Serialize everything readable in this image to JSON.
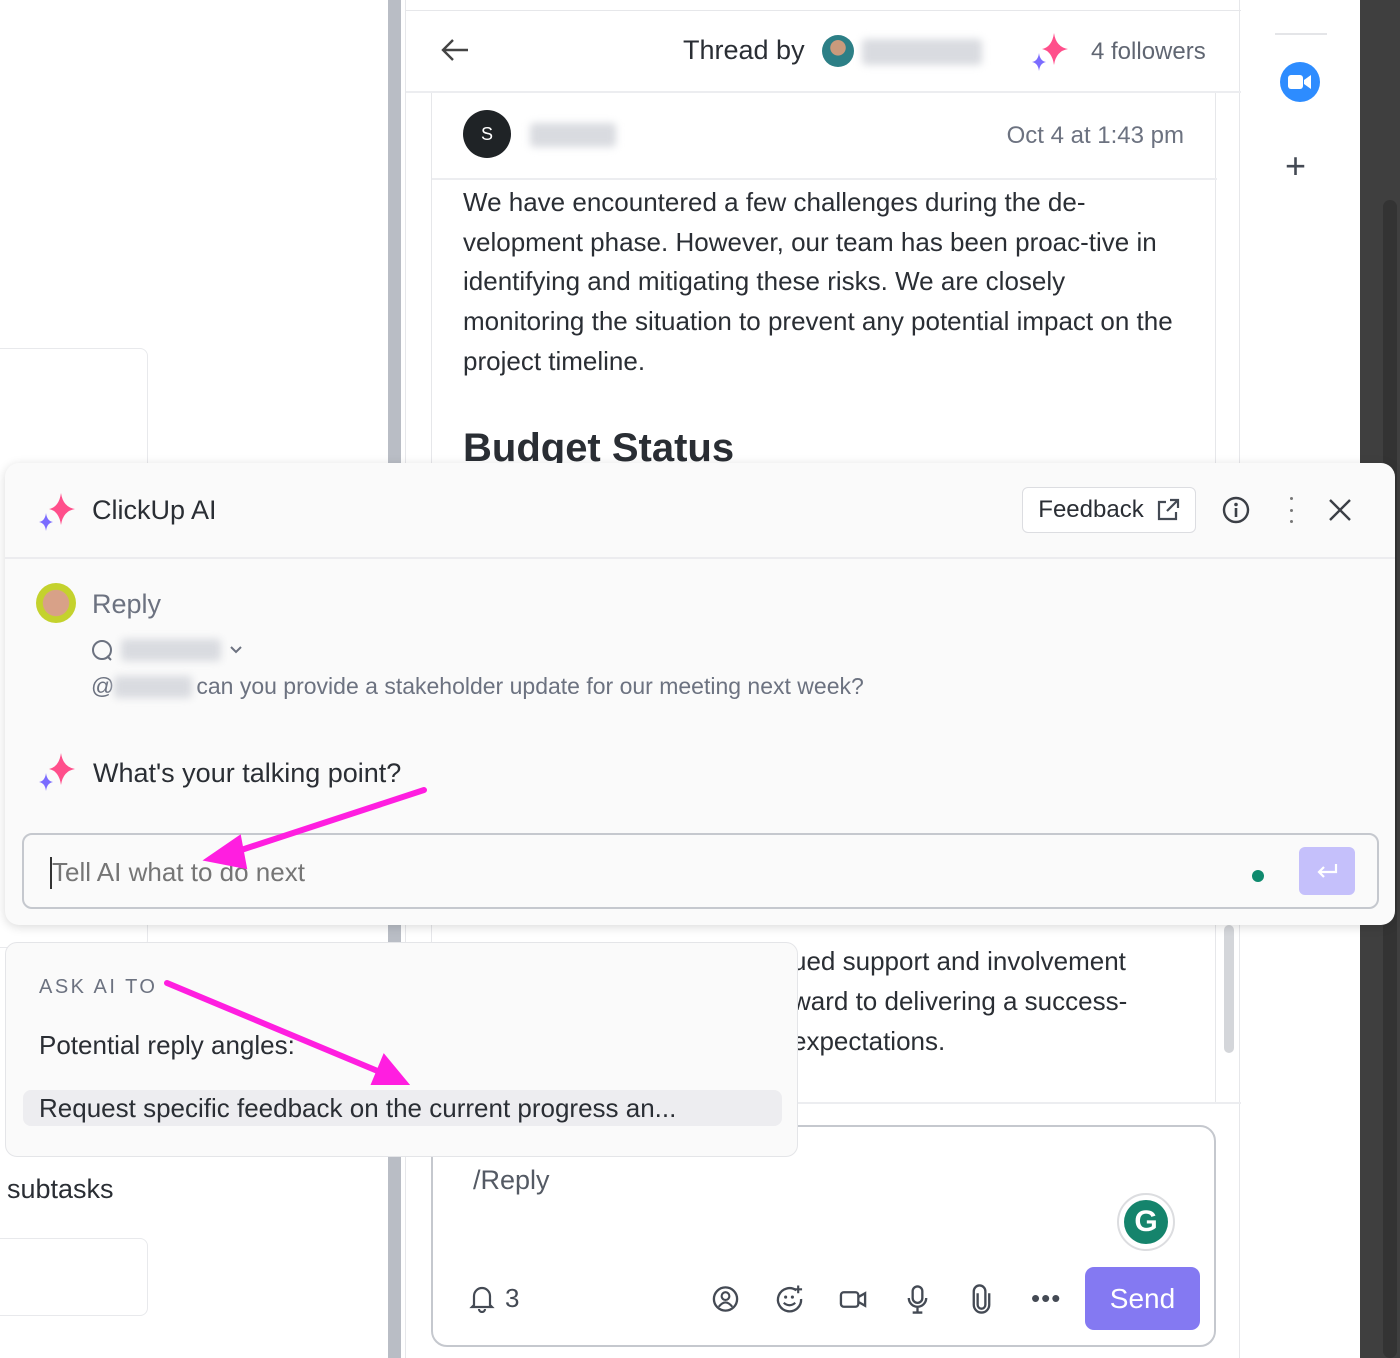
{
  "thread": {
    "title": "Thread by",
    "followers": "4 followers",
    "message": {
      "avatar_initial": "S",
      "timestamp": "Oct 4 at 1:43 pm",
      "paragraph": "We have encountered a few challenges during the de-velopment phase. However, our team has been proac-tive in identifying and mitigating these risks. We are closely monitoring the situation to prevent any potential impact on the project timeline.",
      "heading": "Budget Status",
      "partial_lines": [
        "ued support and involvement",
        "ward to delivering a success-",
        "expectations."
      ]
    }
  },
  "left": {
    "subtasks_label": "subtasks"
  },
  "ai_panel": {
    "title": "ClickUp AI",
    "feedback_label": "Feedback",
    "reply_label": "Reply",
    "quoted_message": "can you provide a stakeholder update for our meeting next week?",
    "mention_prefix": "@",
    "prompt_question": "What's your talking point?",
    "input_placeholder": "Tell AI what to do next"
  },
  "ask_ai": {
    "heading": "ASK AI TO",
    "items": [
      "Potential reply angles:",
      "Request specific feedback on the current progress an..."
    ]
  },
  "composer": {
    "text": "/Reply",
    "notify_count": "3",
    "send_label": "Send"
  },
  "colors": {
    "accent": "#7b68ee",
    "send": "#8479f2",
    "annotation_arrow": "#ff1ee0",
    "zoom_blue": "#2d8cff",
    "grammarly": "#15846c"
  }
}
